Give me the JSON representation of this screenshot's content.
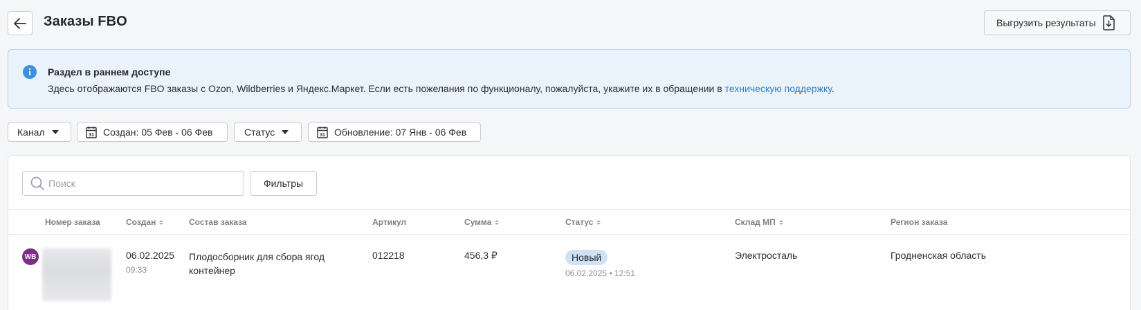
{
  "header": {
    "title": "Заказы FBO",
    "export_label": "Выгрузить результаты"
  },
  "banner": {
    "title": "Раздел в раннем доступе",
    "text": "Здесь отображаются FBO заказы с Ozon, Wildberries и Яндекс.Маркет. Если есть пожелания по функционалу, пожалуйста, укажите их в обращении в ",
    "link": "техническую поддержку",
    "suffix": "."
  },
  "filters": {
    "channel": "Канал",
    "created": "Создан: 05 Фев - 06 Фев",
    "status": "Статус",
    "updated": "Обновление: 07 Янв - 06 Фев"
  },
  "toolbar": {
    "search_placeholder": "Поиск",
    "filters_label": "Фильтры"
  },
  "table": {
    "columns": [
      "Номер заказа",
      "Создан",
      "Состав заказа",
      "Артикул",
      "Сумма",
      "Статус",
      "Склад МП",
      "Регион заказа"
    ],
    "rows": [
      {
        "marketplace": "WB",
        "created_date": "06.02.2025",
        "created_time": "09:33",
        "composition": "Плодосборник для сбора ягод контейнер",
        "article": "012218",
        "sum": "456,3 ₽",
        "status": "Новый",
        "status_updated": "06.02.2025 • 12:51",
        "warehouse": "Электросталь",
        "region": "Гродненская область"
      }
    ]
  },
  "colors": {
    "accent_link": "#2f7fc4",
    "banner_bg": "#eaf3fb",
    "status_pill": "#cfe2f5",
    "wb_badge": "#7b2d87"
  }
}
